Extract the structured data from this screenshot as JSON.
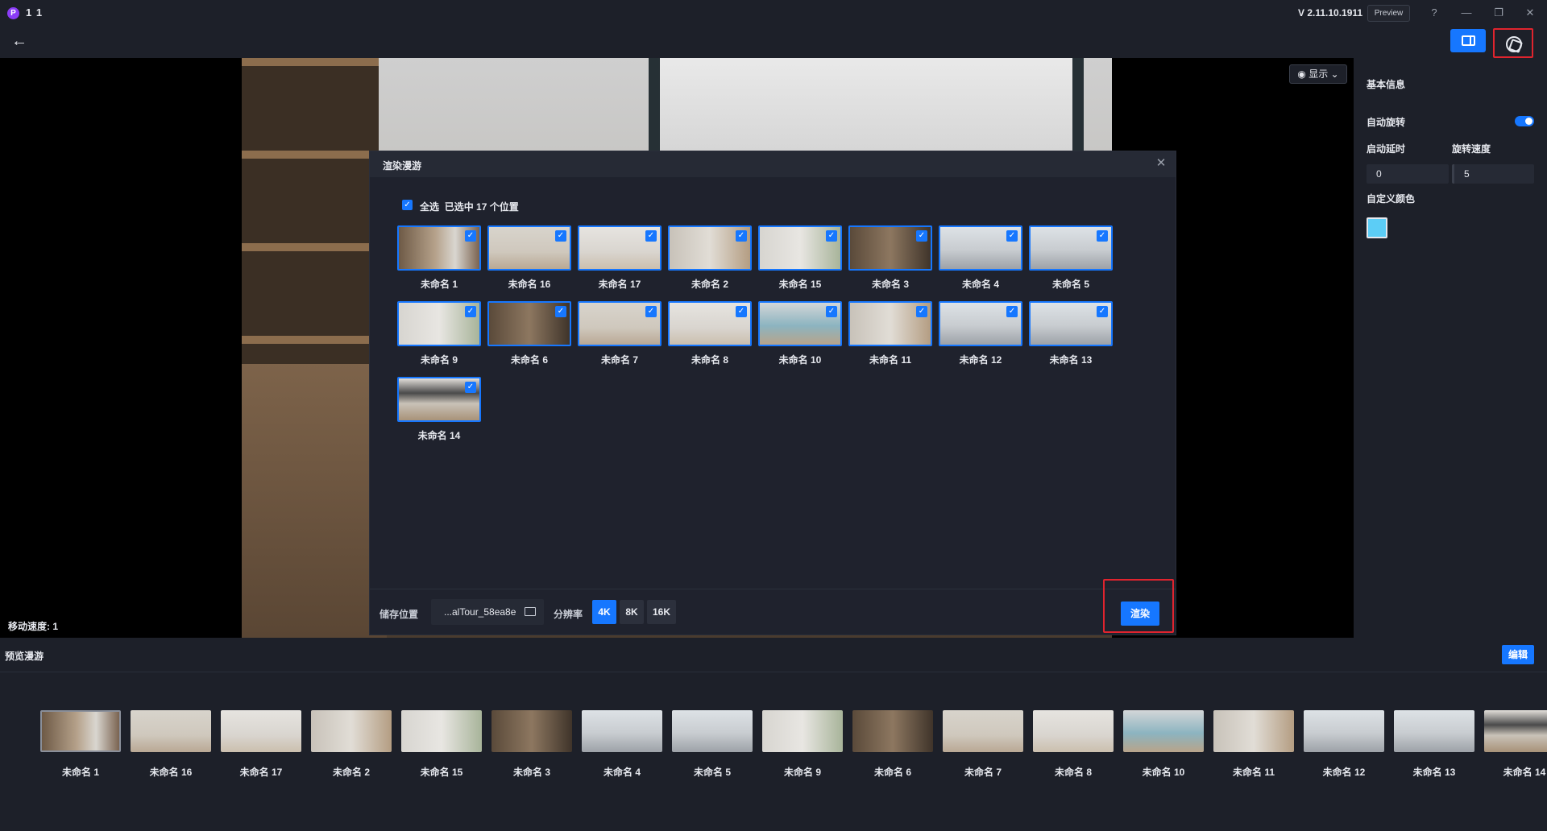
{
  "app": {
    "title": "1 1",
    "logo_letter": "P",
    "version": "V 2.11.10.1911",
    "preview_label": "Preview",
    "help_icon": "?",
    "minimize_icon": "—",
    "restore_icon": "❐",
    "close_icon": "✕"
  },
  "toolbar": {
    "back_icon": "←"
  },
  "viewer": {
    "display_label": "◉ 显示 ⌄",
    "speed_label": "移动速度: 1"
  },
  "panel": {
    "title": "基本信息",
    "auto_rotate_label": "自动旋转",
    "auto_rotate_on": true,
    "delay_label": "启动延时",
    "speed_label": "旋转速度",
    "delay_value": "0",
    "speed_value": "5",
    "color_label": "自定义颜色",
    "color_value": "#5ccdf6"
  },
  "modal": {
    "title": "渲染漫游",
    "close_icon": "✕",
    "select_all": "全选",
    "selected_text": "已选中 17 个位置",
    "check_mark": "✓",
    "items": [
      {
        "name": "未命名 1",
        "tone": "t-wood"
      },
      {
        "name": "未命名 16",
        "tone": "t-bath"
      },
      {
        "name": "未命名 17",
        "tone": "t-white"
      },
      {
        "name": "未命名 2",
        "tone": "t-desk"
      },
      {
        "name": "未命名 15",
        "tone": "t-green"
      },
      {
        "name": "未命名 3",
        "tone": "t-dark"
      },
      {
        "name": "未命名 4",
        "tone": "t-bed"
      },
      {
        "name": "未命名 5",
        "tone": "t-bed"
      },
      {
        "name": "未命名 9",
        "tone": "t-green"
      },
      {
        "name": "未命名 6",
        "tone": "t-dark"
      },
      {
        "name": "未命名 7",
        "tone": "t-bath"
      },
      {
        "name": "未命名 8",
        "tone": "t-white"
      },
      {
        "name": "未命名 10",
        "tone": "t-kitchen"
      },
      {
        "name": "未命名 11",
        "tone": "t-desk"
      },
      {
        "name": "未命名 12",
        "tone": "t-bed"
      },
      {
        "name": "未命名 13",
        "tone": "t-bed"
      },
      {
        "name": "未命名 14",
        "tone": "t-tv"
      }
    ],
    "footer": {
      "storage_label": "储存位置",
      "storage_path": "...alTour_58ea8e",
      "resolution_label": "分辨率",
      "resolutions": [
        "4K",
        "8K",
        "16K"
      ],
      "active_resolution": "4K",
      "render_label": "渲染"
    }
  },
  "strip": {
    "title": "预览漫游",
    "edit_label": "编辑",
    "items": [
      {
        "name": "未命名 1",
        "tone": "t-wood"
      },
      {
        "name": "未命名 16",
        "tone": "t-bath"
      },
      {
        "name": "未命名 17",
        "tone": "t-white"
      },
      {
        "name": "未命名 2",
        "tone": "t-desk"
      },
      {
        "name": "未命名 15",
        "tone": "t-green"
      },
      {
        "name": "未命名 3",
        "tone": "t-dark"
      },
      {
        "name": "未命名 4",
        "tone": "t-bed"
      },
      {
        "name": "未命名 5",
        "tone": "t-bed"
      },
      {
        "name": "未命名 9",
        "tone": "t-green"
      },
      {
        "name": "未命名 6",
        "tone": "t-dark"
      },
      {
        "name": "未命名 7",
        "tone": "t-bath"
      },
      {
        "name": "未命名 8",
        "tone": "t-white"
      },
      {
        "name": "未命名 10",
        "tone": "t-kitchen"
      },
      {
        "name": "未命名 11",
        "tone": "t-desk"
      },
      {
        "name": "未命名 12",
        "tone": "t-bed"
      },
      {
        "name": "未命名 13",
        "tone": "t-bed"
      },
      {
        "name": "未命名 14",
        "tone": "t-tv"
      }
    ]
  },
  "colors": {
    "accent": "#1677ff",
    "highlight_border": "#e0242e",
    "background": "#1d2029"
  }
}
